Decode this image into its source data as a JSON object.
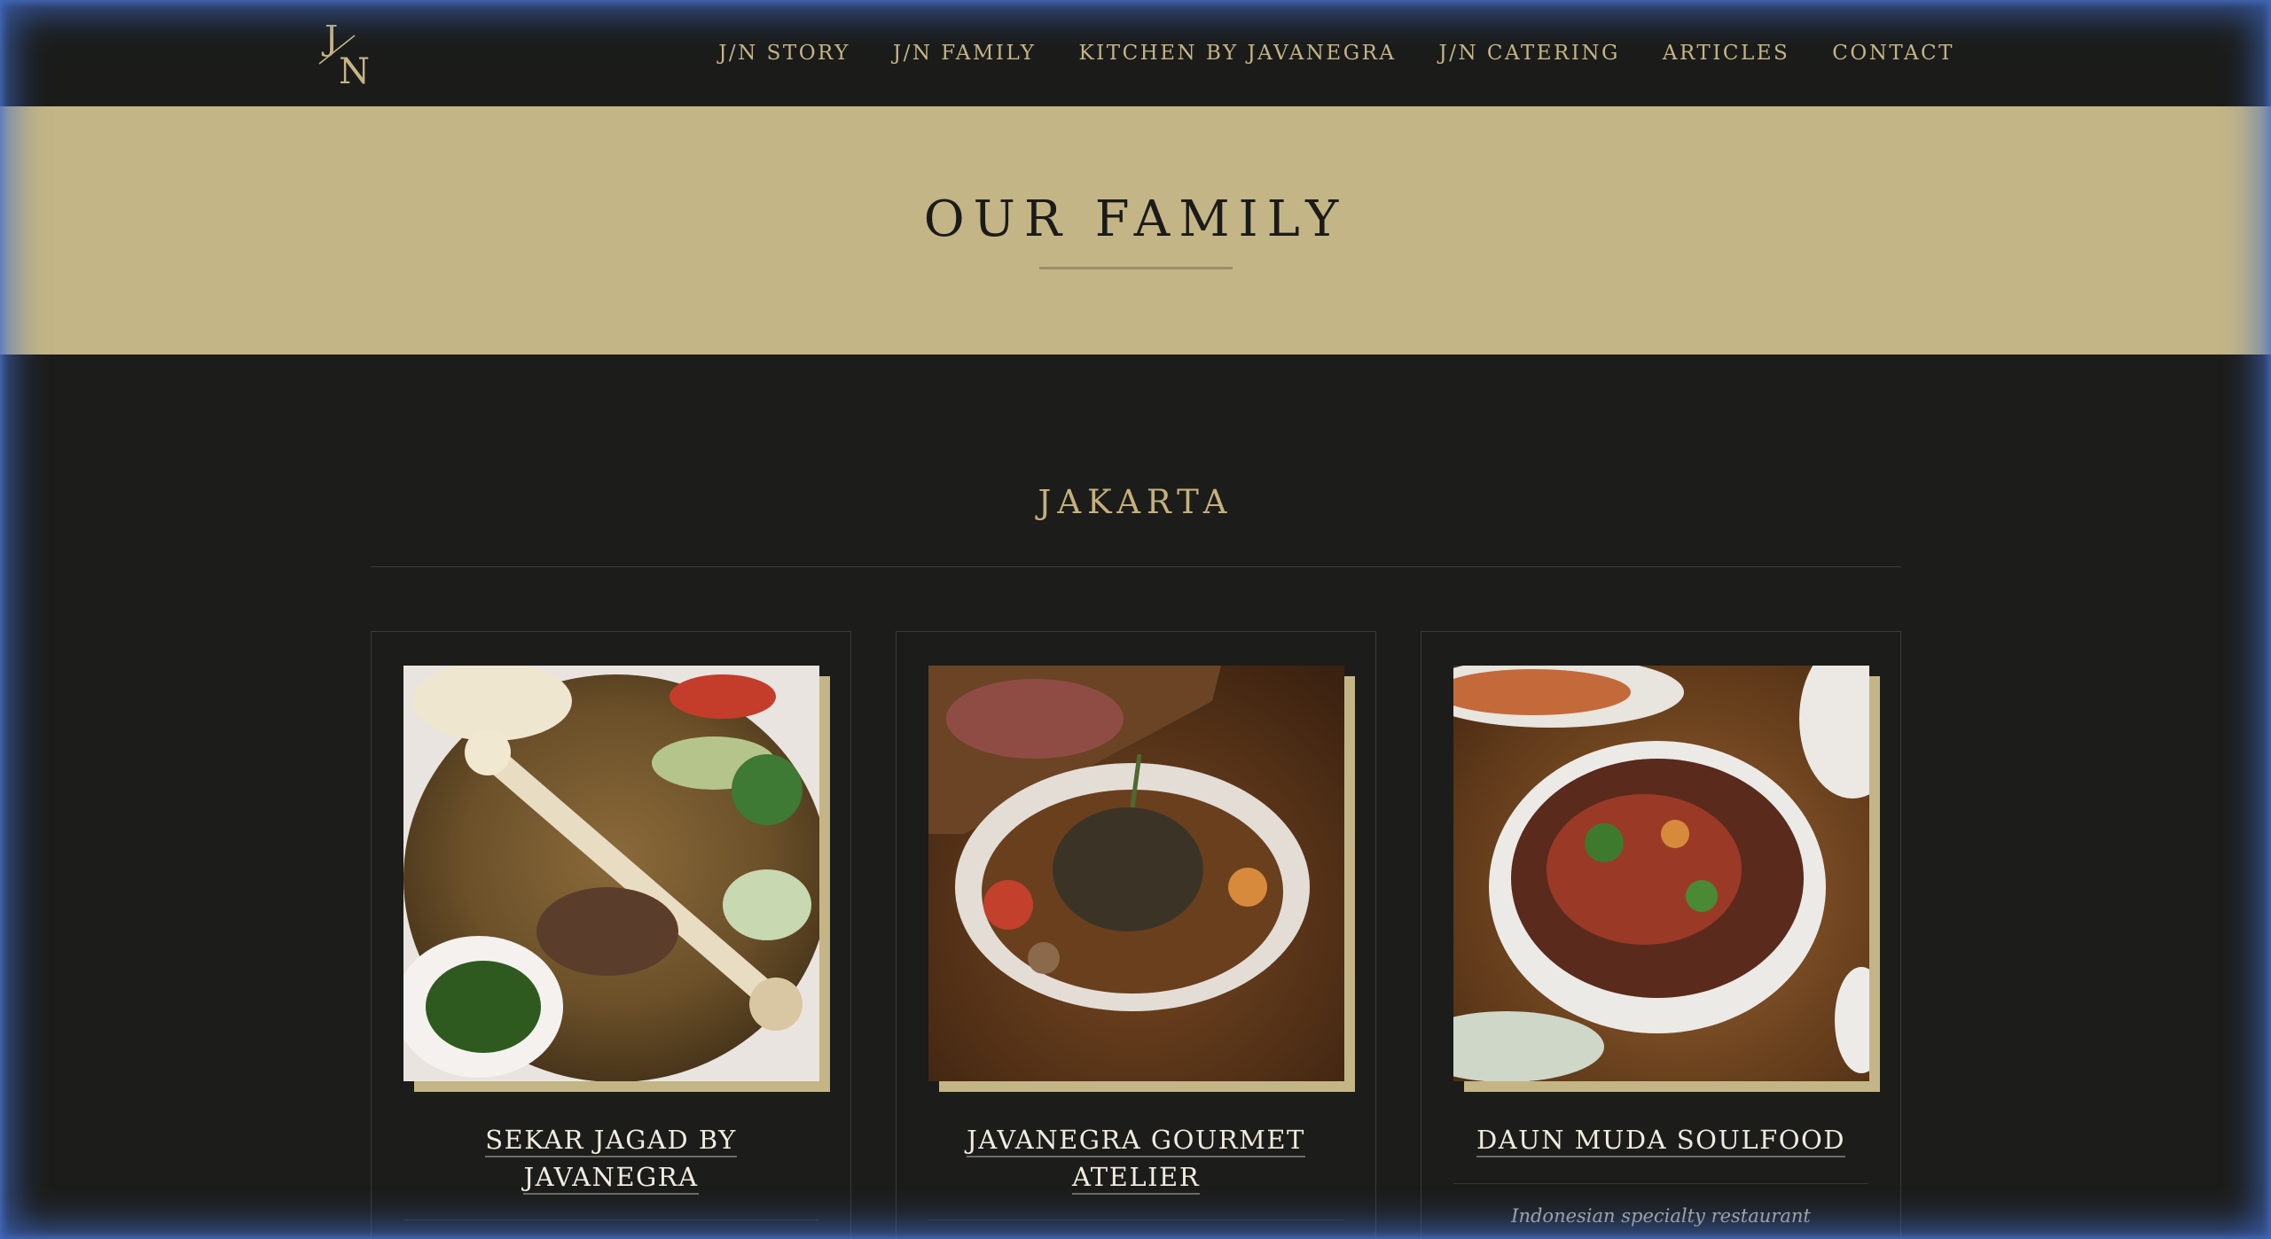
{
  "header": {
    "logo_text": "J/N",
    "nav": [
      {
        "label": "J/N STORY"
      },
      {
        "label": "J/N FAMILY"
      },
      {
        "label": "KITCHEN BY JAVANEGRA"
      },
      {
        "label": "J/N CATERING"
      },
      {
        "label": "ARTICLES"
      },
      {
        "label": "CONTACT"
      }
    ]
  },
  "hero": {
    "title": "OUR FAMILY"
  },
  "section": {
    "title": "JAKARTA"
  },
  "cards": [
    {
      "title_line1": "SEKAR JAGAD BY",
      "title_line2": "JAVANEGRA",
      "image_icon": "rice-dish-photo-icon"
    },
    {
      "title_line1": "JAVANEGRA GOURMET",
      "title_line2": "ATELIER",
      "image_icon": "plated-meat-photo-icon"
    },
    {
      "title_line1": "DAUN MUDA SOULFOOD",
      "description": "Indonesian specialty restaurant",
      "image_icon": "salad-bowl-photo-icon"
    }
  ],
  "colors": {
    "background": "#1c1c1a",
    "gold": "#c4b586",
    "nav_text": "#c7b586",
    "title_text": "#f1ece0"
  }
}
